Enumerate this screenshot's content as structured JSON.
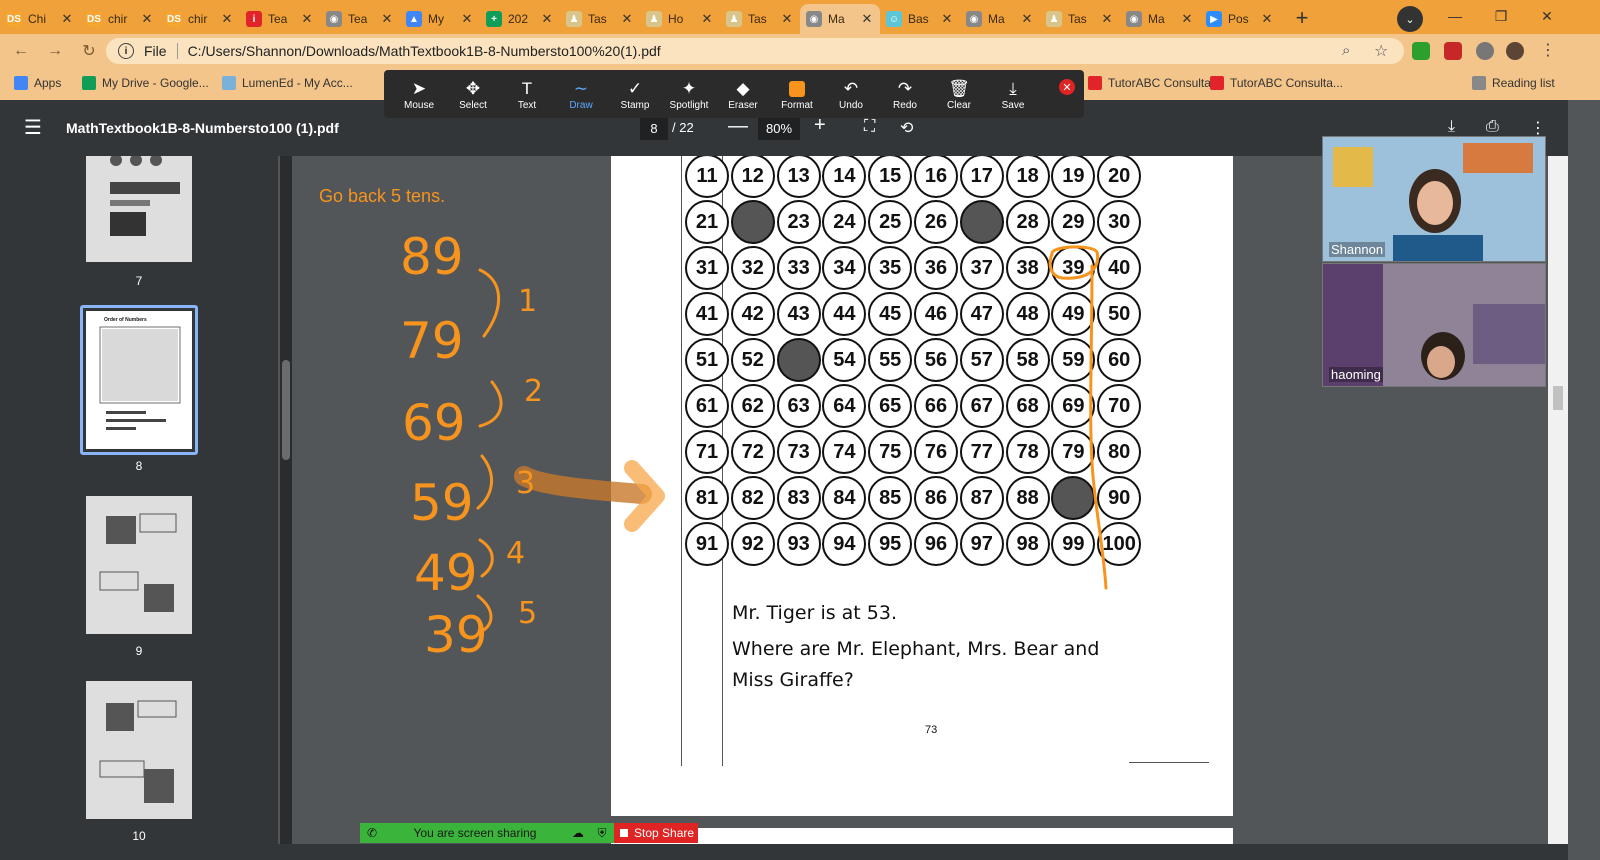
{
  "tabs": [
    {
      "label": "Chi",
      "fav_color": "#f7a531",
      "fav_glyph": "DS"
    },
    {
      "label": "chir",
      "fav_color": "#f7a531",
      "fav_glyph": "DS"
    },
    {
      "label": "chir",
      "fav_color": "#f7a531",
      "fav_glyph": "DS"
    },
    {
      "label": "Tea",
      "fav_color": "#e0242a",
      "fav_glyph": "i"
    },
    {
      "label": "Tea",
      "fav_color": "#888888",
      "fav_glyph": "◉"
    },
    {
      "label": "My",
      "fav_color": "#4285f4",
      "fav_glyph": "▲"
    },
    {
      "label": "202",
      "fav_color": "#0f9d58",
      "fav_glyph": "+"
    },
    {
      "label": "Tas",
      "fav_color": "#d9c48a",
      "fav_glyph": "♟"
    },
    {
      "label": "Ho",
      "fav_color": "#d9c48a",
      "fav_glyph": "♟"
    },
    {
      "label": "Tas",
      "fav_color": "#d9c48a",
      "fav_glyph": "♟"
    },
    {
      "label": "Ma",
      "fav_color": "#888888",
      "fav_glyph": "◉",
      "active": true
    },
    {
      "label": "Bas",
      "fav_color": "#5cc6d6",
      "fav_glyph": "☺"
    },
    {
      "label": "Ma",
      "fav_color": "#888888",
      "fav_glyph": "◉"
    },
    {
      "label": "Tas",
      "fav_color": "#d9c48a",
      "fav_glyph": "♟"
    },
    {
      "label": "Ma",
      "fav_color": "#888888",
      "fav_glyph": "◉"
    },
    {
      "label": "Pos",
      "fav_color": "#2d8cff",
      "fav_glyph": "▶"
    }
  ],
  "tab_close_glyph": "✕",
  "new_tab_glyph": "+",
  "window": {
    "minimize": "—",
    "restore": "❐",
    "close": "✕"
  },
  "address": {
    "scheme": "File",
    "url": "C:/Users/Shannon/Downloads/MathTextbook1B-8-Numbersto100%20(1).pdf"
  },
  "bookmarks": [
    {
      "label": "Apps",
      "icon_color": "#4285f4"
    },
    {
      "label": "My Drive - Google...",
      "icon_color": "#0f9d58"
    },
    {
      "label": "LumenEd - My Acc...",
      "icon_color": "#7bb0d8"
    },
    {
      "label": "TutorABC Consulta...",
      "icon_color": "#e0242a"
    },
    {
      "label": "TutorABC Consulta...",
      "icon_color": "#e0242a"
    },
    {
      "label": "Reading list",
      "icon_color": "#888888"
    }
  ],
  "annotation_tools": [
    {
      "label": "Mouse",
      "icon": "➤",
      "name": "mouse-tool"
    },
    {
      "label": "Select",
      "icon": "✥",
      "name": "select-tool"
    },
    {
      "label": "Text",
      "icon": "T",
      "name": "text-tool"
    },
    {
      "label": "Draw",
      "icon": "∼",
      "name": "draw-tool",
      "active": true
    },
    {
      "label": "Stamp",
      "icon": "✓",
      "name": "stamp-tool"
    },
    {
      "label": "Spotlight",
      "icon": "✦",
      "name": "spotlight-tool"
    },
    {
      "label": "Eraser",
      "icon": "◆",
      "name": "eraser-tool"
    },
    {
      "label": "Format",
      "icon": "",
      "name": "format-tool"
    },
    {
      "label": "Undo",
      "icon": "↶",
      "name": "undo-tool"
    },
    {
      "label": "Redo",
      "icon": "↷",
      "name": "redo-tool"
    },
    {
      "label": "Clear",
      "icon": "🗑",
      "name": "clear-tool"
    },
    {
      "label": "Save",
      "icon": "⤓",
      "name": "save-tool"
    }
  ],
  "annotation_close_glyph": "✕",
  "format_color": "#f7941d",
  "pdf": {
    "title": "MathTextbook1B-8-Numbersto100 (1).pdf",
    "page": "8",
    "total": "/ 22",
    "zoom": "80%",
    "menu_glyph": "☰",
    "zoom_minus": "—",
    "zoom_plus": "+"
  },
  "thumbnails": [
    {
      "num": "7"
    },
    {
      "num": "8",
      "selected": true,
      "title": "Order of Numbers"
    },
    {
      "num": "9"
    },
    {
      "num": "10"
    }
  ],
  "page_content": {
    "grid_rows": [
      [
        "11",
        "12",
        "13",
        "14",
        "15",
        "16",
        "17",
        "18",
        "19",
        "20"
      ],
      [
        "21",
        "",
        "23",
        "24",
        "25",
        "26",
        "",
        "28",
        "29",
        "30"
      ],
      [
        "31",
        "32",
        "33",
        "34",
        "35",
        "36",
        "37",
        "38",
        "39",
        "40"
      ],
      [
        "41",
        "42",
        "43",
        "44",
        "45",
        "46",
        "47",
        "48",
        "49",
        "50"
      ],
      [
        "51",
        "52",
        "",
        "54",
        "55",
        "56",
        "57",
        "58",
        "59",
        "60"
      ],
      [
        "61",
        "62",
        "63",
        "64",
        "65",
        "66",
        "67",
        "68",
        "69",
        "70"
      ],
      [
        "71",
        "72",
        "73",
        "74",
        "75",
        "76",
        "77",
        "78",
        "79",
        "80"
      ],
      [
        "81",
        "82",
        "83",
        "84",
        "85",
        "86",
        "87",
        "88",
        "",
        "90"
      ],
      [
        "91",
        "92",
        "93",
        "94",
        "95",
        "96",
        "97",
        "98",
        "99",
        "100"
      ]
    ],
    "question_line1": "Mr. Tiger is at 53.",
    "question_line2": "Where are Mr. Elephant, Mrs. Bear and",
    "question_line3": "Miss Giraffe?",
    "page_number": "73"
  },
  "annotations": {
    "heading": "Go back 5 tens.",
    "numbers": [
      "89",
      "79",
      "69",
      "59",
      "49",
      "39"
    ],
    "steps": [
      "1",
      "2",
      "3",
      "4",
      "5"
    ],
    "ink_color": "#f7941d"
  },
  "participants": [
    {
      "name": "Shannon"
    },
    {
      "name": "haoming"
    }
  ],
  "share": {
    "status": "You are screen sharing",
    "stop": "Stop Share"
  }
}
